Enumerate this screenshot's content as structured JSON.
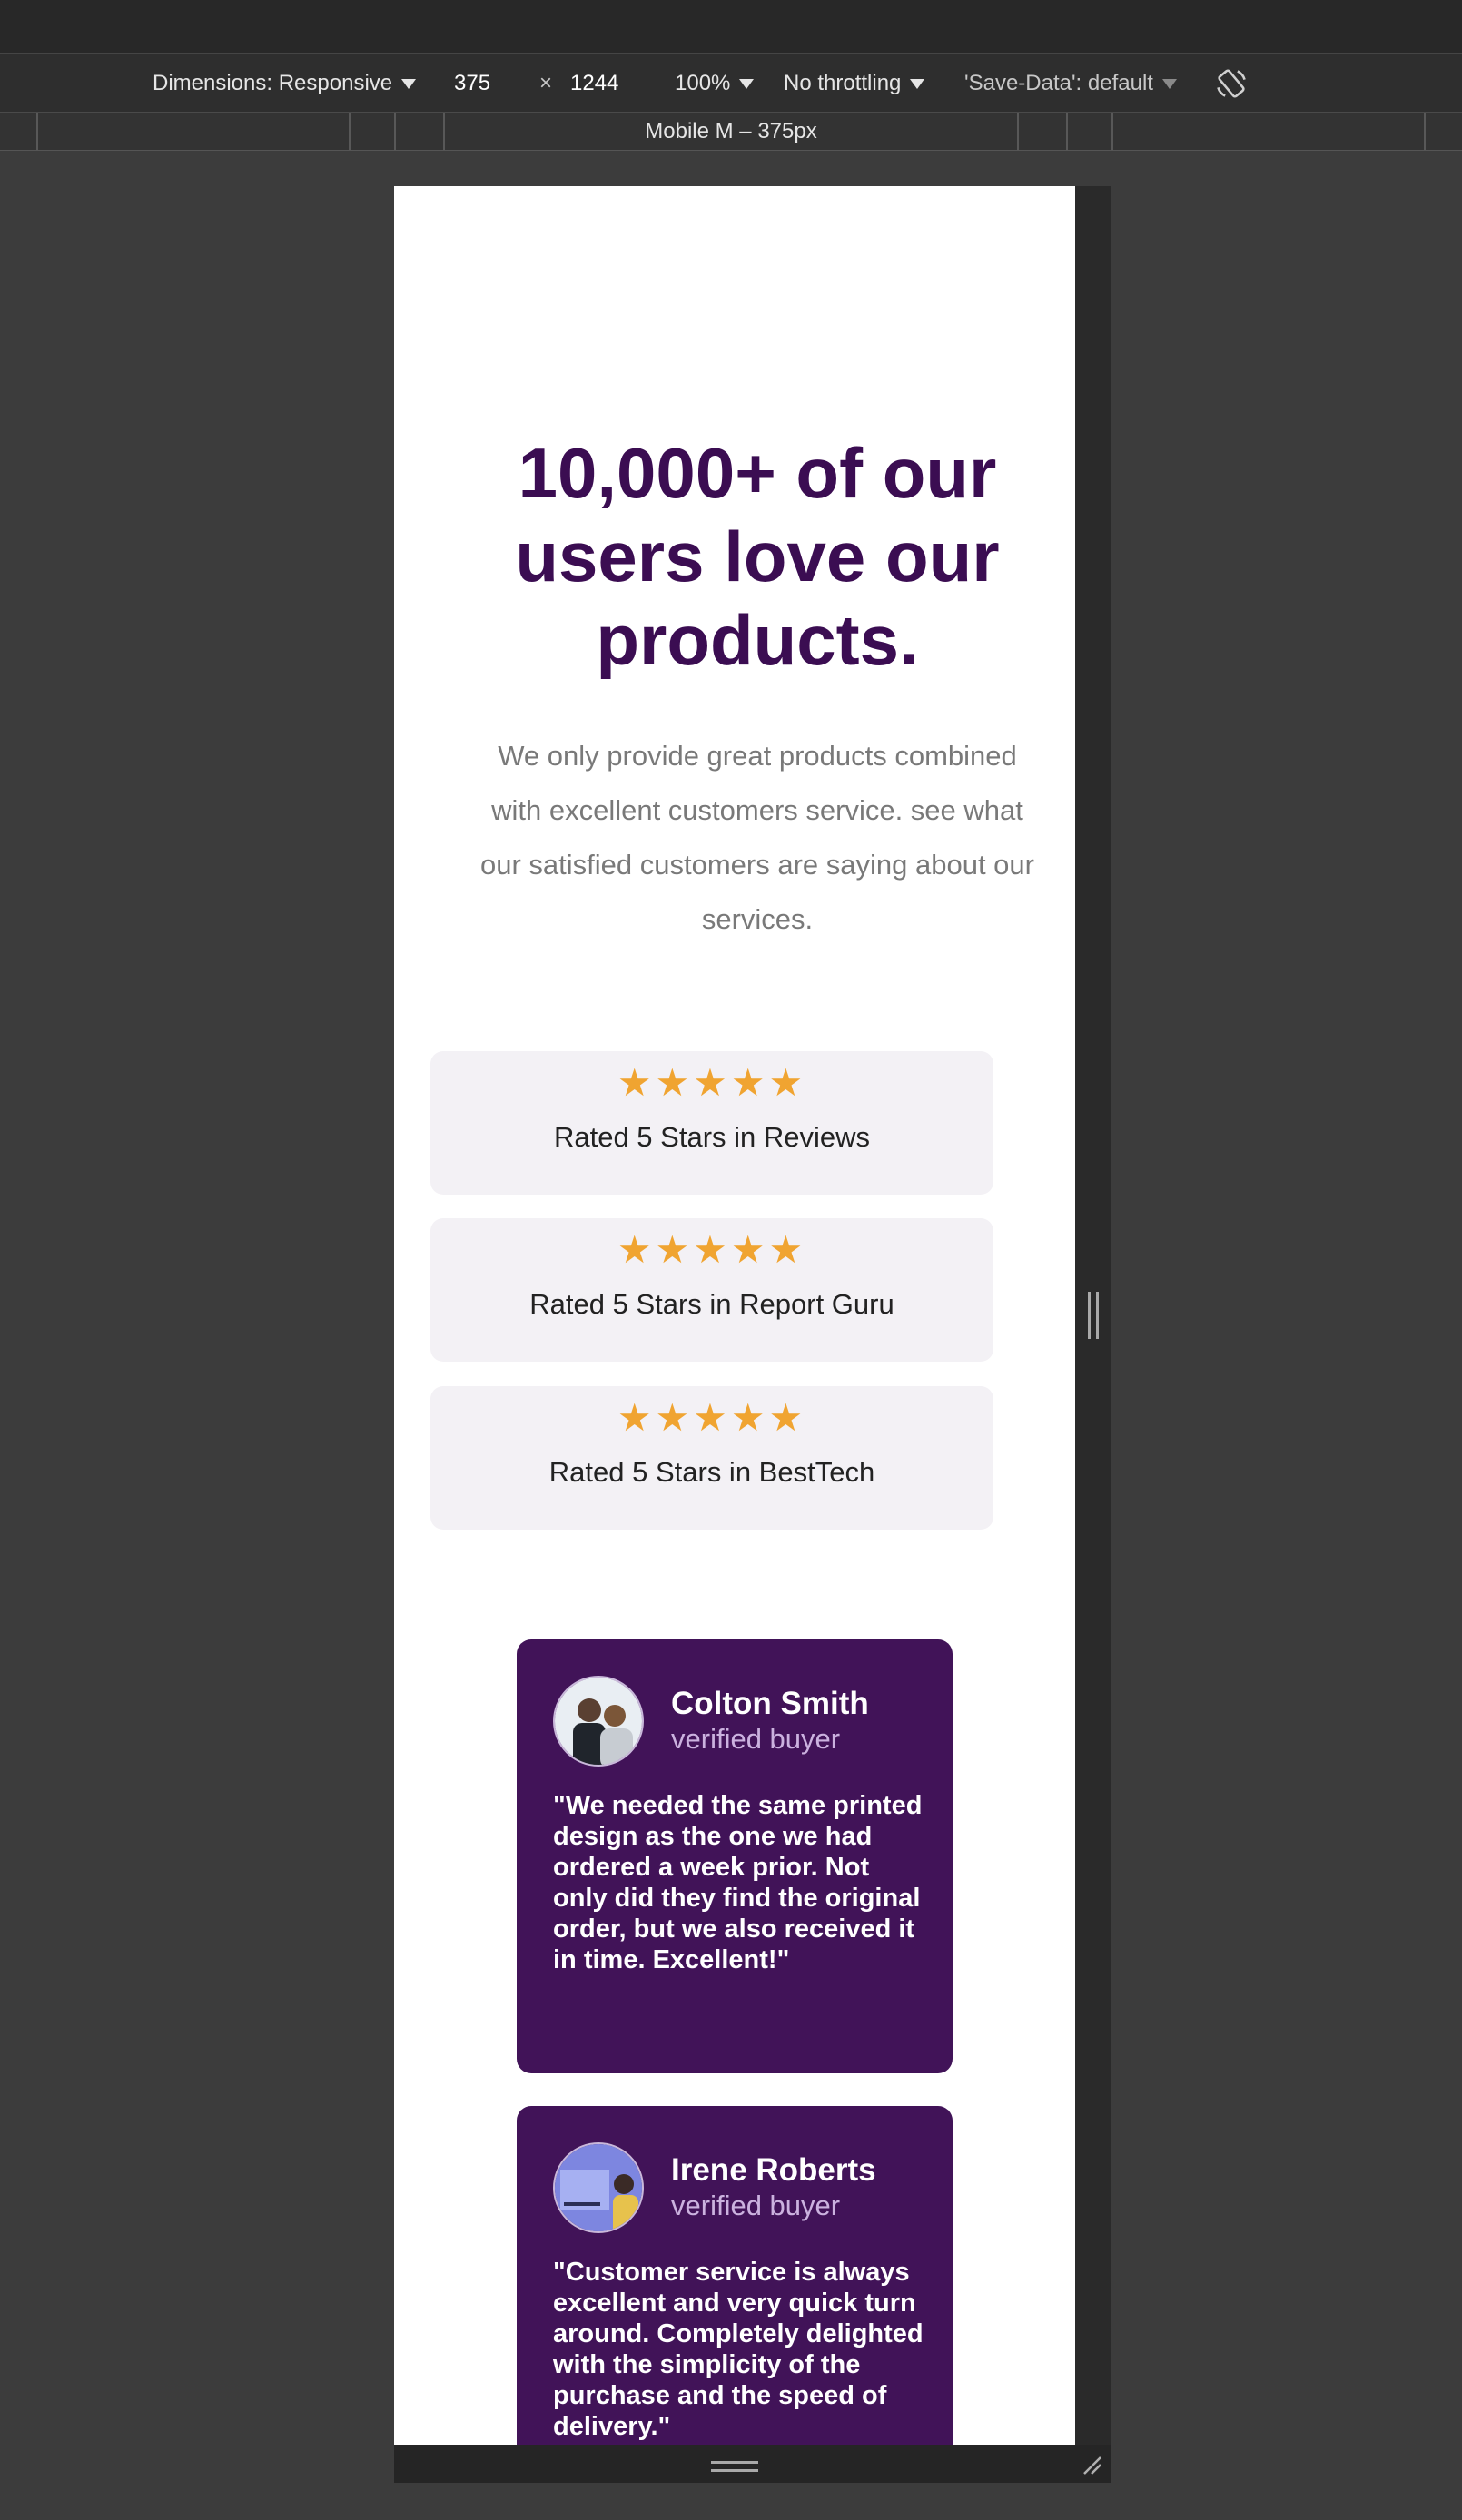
{
  "devtools": {
    "dimensions_label": "Dimensions: Responsive",
    "width_value": "375",
    "times_sign": "×",
    "height_value": "1244",
    "zoom": "100%",
    "throttling": "No throttling",
    "save_data": "'Save-Data': default",
    "device_label": "Mobile M – 375px"
  },
  "page": {
    "heading": "10,000+ of our users love our products.",
    "intro": "We only provide great products combined with excellent customers service. see what our satisfied customers are saying about our services.",
    "star_glyphs": "★★★★★",
    "star_color": "#f0a431",
    "heading_color": "#3b0d52",
    "card_color": "#411358",
    "ratings": [
      {
        "label": "Rated 5 Stars in Reviews",
        "stars": 5
      },
      {
        "label": "Rated 5 Stars in Report Guru",
        "stars": 5
      },
      {
        "label": "Rated 5 Stars in BestTech",
        "stars": 5
      }
    ],
    "testimonials": [
      {
        "name": "Colton Smith",
        "role": "verified buyer",
        "quote": "\"We needed the same printed design as the one we had ordered a week prior. Not only did they find the original order, but we also received it in time. Excellent!\""
      },
      {
        "name": "Irene Roberts",
        "role": "verified buyer",
        "quote": "\"Customer service is always excellent and very quick turn around. Completely delighted with the simplicity of the purchase and the speed of delivery.\""
      }
    ]
  }
}
